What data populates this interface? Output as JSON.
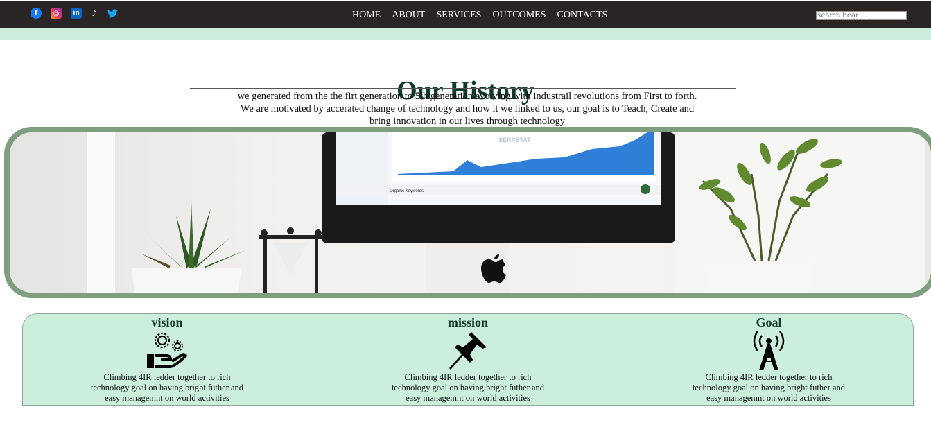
{
  "header": {
    "social": [
      {
        "name": "facebook-icon",
        "glyph": "f"
      },
      {
        "name": "instagram-icon",
        "glyph": "◎"
      },
      {
        "name": "linkedin-icon",
        "glyph": "in"
      },
      {
        "name": "tiktok-icon",
        "glyph": "♪"
      },
      {
        "name": "twitter-icon",
        "glyph": "🐦"
      }
    ],
    "nav": [
      "HOME",
      "ABOUT",
      "SERVICES",
      "OUTCOMES",
      "CONTACTS"
    ],
    "search_placeholder": "search hear ..."
  },
  "main": {
    "title": "Our History",
    "intro": "we generated from the the firt generation to 5th generation evolving with industrail revolutions from First to forth. We are motivated by accerated change of technology and how it we linked to us, our goal is to Teach, Create and bring innovation in our lives through technology"
  },
  "cards": [
    {
      "title": "vision",
      "icon": "hand-gear-icon",
      "text": "Climbing 4IR ledder together to rich technology goal on having bright futher and easy managemnt on world activities"
    },
    {
      "title": "mission",
      "icon": "pushpin-icon",
      "text": "Climbing 4IR ledder together to rich technology goal on having bright futher and easy managemnt on world activities"
    },
    {
      "title": "Goal",
      "icon": "radio-tower-icon",
      "text": "Climbing 4IR ledder together to rich technology goal on having bright futher and easy managemnt on world activities"
    }
  ],
  "hero_image": {
    "screen_label": "Organic Keywords",
    "screen_brand": "SERPSTAT"
  },
  "colors": {
    "topbar": "#292524",
    "accent_green": "#cdeedd",
    "frame_green": "#7e9e7d",
    "title": "#0f3a2a"
  }
}
